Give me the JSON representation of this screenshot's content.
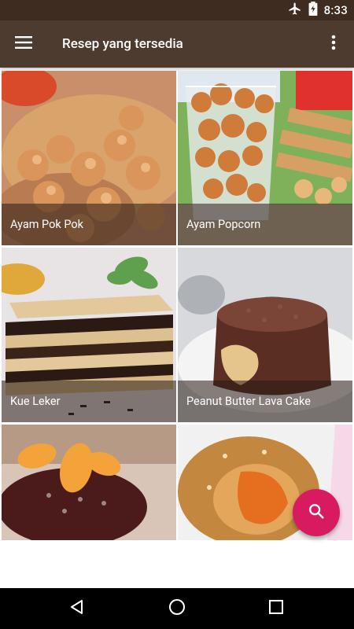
{
  "status_bar": {
    "time": "8:33",
    "icons": [
      "airplane-icon",
      "battery-icon"
    ]
  },
  "app_bar": {
    "title": "Resep yang tersedia",
    "menu_icon": "hamburger-menu-icon",
    "more_icon": "more-vertical-icon"
  },
  "recipes": [
    {
      "name": "Ayam Pok Pok"
    },
    {
      "name": "Ayam Popcorn"
    },
    {
      "name": "Kue Leker"
    },
    {
      "name": "Peanut Butter Lava Cake"
    },
    {
      "name": ""
    },
    {
      "name": ""
    }
  ],
  "fab": {
    "icon": "search-icon"
  },
  "nav_bar": {
    "icons": [
      "back-icon",
      "home-icon",
      "recents-icon"
    ]
  },
  "colors": {
    "status_bar": "#3e2c21",
    "app_bar": "#4e3b30",
    "fab": "#d81b60"
  }
}
